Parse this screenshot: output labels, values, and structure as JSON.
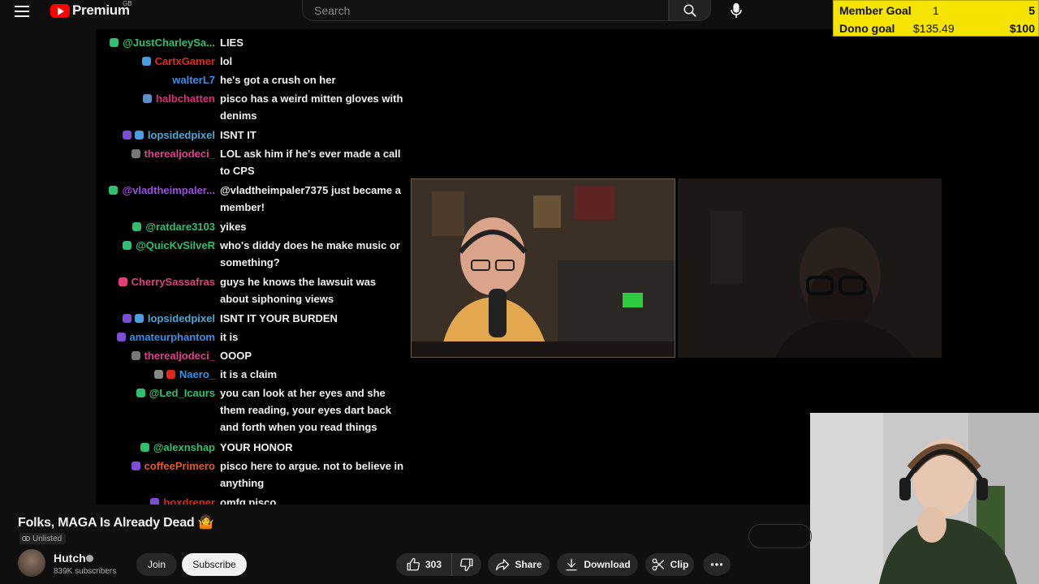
{
  "header": {
    "logo_text": "Premium",
    "region": "GB",
    "search_placeholder": "Search"
  },
  "goals": {
    "member_label": "Member Goal",
    "member_current": "1",
    "member_target": "5",
    "dono_label": "Dono goal",
    "dono_current": "$135.49",
    "dono_target": "$100",
    "bg_color": "#f4e400"
  },
  "chat": [
    {
      "name": "@JustCharleySa...",
      "text": "LIES",
      "color": "#2fbf71",
      "badges": [
        "#2fbf71"
      ]
    },
    {
      "name": "CartxGamer",
      "text": "lol",
      "color": "#e0281c",
      "badges": [
        "#4a9de0"
      ]
    },
    {
      "name": "walterL7",
      "text": "he's got a crush on her",
      "color": "#3a8ee6",
      "badges": []
    },
    {
      "name": "halbchatten",
      "text": "pisco has a weird mitten gloves with denims",
      "color": "#e02a7a",
      "badges": [
        "#5a8fc7"
      ]
    },
    {
      "name": "lopsidedpixel",
      "text": "ISNT IT",
      "color": "#49a8d8",
      "badges": [
        "#7c4dd8",
        "#4a9de0"
      ]
    },
    {
      "name": "therealjodeci_",
      "text": "LOL ask him if he's ever made a call to CPS",
      "color": "#e0408f",
      "badges": [
        "#777"
      ]
    },
    {
      "name": "@vladtheimpaler...",
      "text": "@vladtheimpaler7375 just became a member!",
      "color": "#9a4fe0",
      "badges": [
        "#2fbf71"
      ]
    },
    {
      "name": "@ratdare3103",
      "text": "yikes",
      "color": "#2fbf71",
      "badges": [
        "#2fbf71"
      ]
    },
    {
      "name": "@QuicKvSilveR",
      "text": "who's diddy does he make music or something?",
      "color": "#2fbf71",
      "badges": [
        "#2fbf71"
      ]
    },
    {
      "name": "CherrySassafras",
      "text": "guys he knows the lawsuit was about siphoning views",
      "color": "#e0407a",
      "badges": [
        "#e0407a"
      ]
    },
    {
      "name": "lopsidedpixel",
      "text": "ISNT IT YOUR BURDEN",
      "color": "#49a8d8",
      "badges": [
        "#7c4dd8",
        "#4a9de0"
      ]
    },
    {
      "name": "amateurphantom",
      "text": "it is",
      "color": "#3a8ee6",
      "badges": [
        "#7c4dd8"
      ]
    },
    {
      "name": "therealjodeci_",
      "text": "OOOP",
      "color": "#e0408f",
      "badges": [
        "#777"
      ]
    },
    {
      "name": "Naero_",
      "text": "it is a claim",
      "color": "#3a8ee6",
      "badges": [
        "#888",
        "#e0281c"
      ]
    },
    {
      "name": "@Led_Icaurs",
      "text": "you can look at her eyes and she them reading, your eyes dart back and forth when you read things",
      "color": "#2fbf71",
      "badges": [
        "#2fbf71"
      ]
    },
    {
      "name": "@alexnshap",
      "text": "YOUR HONOR",
      "color": "#2fbf71",
      "badges": [
        "#2fbf71"
      ]
    },
    {
      "name": "coffeePrimero",
      "text": "pisco here to argue. not to believe in anything",
      "color": "#e05a2a",
      "badges": [
        "#7c4dd8"
      ]
    },
    {
      "name": "boxdreper",
      "text": "omfg pisco",
      "color": "#e0281c",
      "badges": [
        "#7c4dd8"
      ]
    }
  ],
  "video": {
    "title": "Folks, MAGA Is Already Dead",
    "visibility": "Unlisted"
  },
  "channel": {
    "name": "Hutch",
    "subscribers": "839K subscribers",
    "join_label": "Join",
    "subscribe_label": "Subscribe"
  },
  "actions": {
    "like_count": "303",
    "share_label": "Share",
    "download_label": "Download",
    "clip_label": "Clip"
  }
}
